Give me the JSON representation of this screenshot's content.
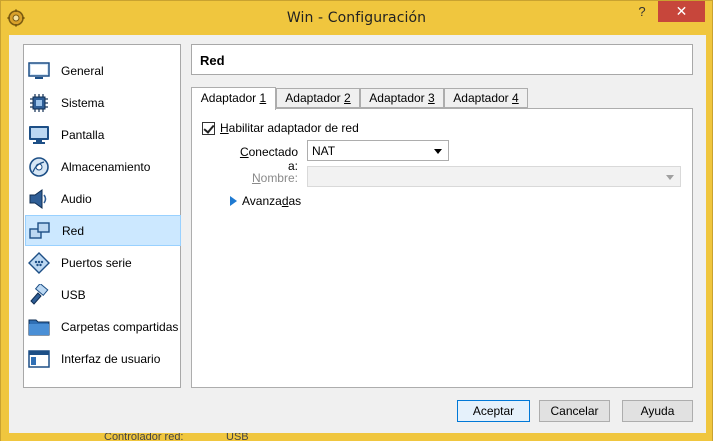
{
  "window": {
    "title": "Win - Configuración",
    "help_glyph": "?",
    "close_glyph": "✕"
  },
  "sidebar": {
    "items": [
      {
        "label": "General",
        "icon": "general-icon",
        "selected": false
      },
      {
        "label": "Sistema",
        "icon": "chip-icon",
        "selected": false
      },
      {
        "label": "Pantalla",
        "icon": "monitor-icon",
        "selected": false
      },
      {
        "label": "Almacenamiento",
        "icon": "disk-icon",
        "selected": false
      },
      {
        "label": "Audio",
        "icon": "speaker-icon",
        "selected": false
      },
      {
        "label": "Red",
        "icon": "network-icon",
        "selected": true
      },
      {
        "label": "Puertos serie",
        "icon": "serial-port-icon",
        "selected": false
      },
      {
        "label": "USB",
        "icon": "usb-icon",
        "selected": false
      },
      {
        "label": "Carpetas compartidas",
        "icon": "folder-icon",
        "selected": false
      },
      {
        "label": "Interfaz de usuario",
        "icon": "ui-window-icon",
        "selected": false
      }
    ]
  },
  "section": {
    "title": "Red"
  },
  "tabs": [
    {
      "label": "Adaptador ",
      "mnemonic": "1",
      "active": true
    },
    {
      "label": "Adaptador ",
      "mnemonic": "2",
      "active": false
    },
    {
      "label": "Adaptador ",
      "mnemonic": "3",
      "active": false
    },
    {
      "label": "Adaptador ",
      "mnemonic": "4",
      "active": false
    }
  ],
  "adapter": {
    "enable_mnemonic": "H",
    "enable_label_rest": "abilitar adaptador de red",
    "enable_checked": true,
    "connected_label_mnemonic": "C",
    "connected_label_rest": "onectado a:",
    "connected_value": "NAT",
    "name_label_mnemonic": "N",
    "name_label_rest": "ombre:",
    "name_value": "",
    "advanced_pre": "Avanza",
    "advanced_mnemonic": "d",
    "advanced_post": "as"
  },
  "buttons": {
    "ok": "Aceptar",
    "cancel": "Cancelar",
    "help": "Ayuda"
  },
  "background_window": {
    "text1": "Controlador red:",
    "text2": "USB"
  },
  "colors": {
    "titlebar": "#f0c63e",
    "close": "#c7463b",
    "selection": "#cce8ff",
    "accent": "#0078d7"
  }
}
